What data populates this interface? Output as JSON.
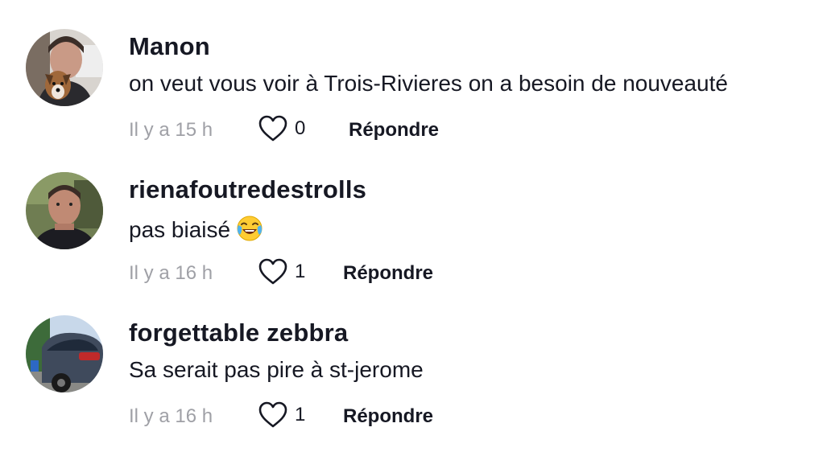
{
  "comments": [
    {
      "username": "Manon",
      "text": "on veut vous voir à Trois-Rivieres on a besoin de nouveauté",
      "time": "Il y a 15 h",
      "likes": "0",
      "reply_label": "Répondre",
      "like_icon": "heart-outline-icon",
      "avatar": "user-avatar-with-dog"
    },
    {
      "username": "rienafoutredestrolls",
      "text": "pas biaisé",
      "emoji": "face-with-tears-of-joy",
      "time": "Il y a 16 h",
      "likes": "1",
      "reply_label": "Répondre",
      "like_icon": "heart-outline-icon",
      "avatar": "user-avatar-man"
    },
    {
      "username": "forgettable zebbra",
      "text": "Sa serait pas pire à st-jerome",
      "time": "Il y a 16 h",
      "likes": "1",
      "reply_label": "Répondre",
      "like_icon": "heart-outline-icon",
      "avatar": "user-avatar-car"
    }
  ],
  "colors": {
    "primary_text": "#161823",
    "secondary_text": "#9fa0a6",
    "icon_stroke": "#161823"
  }
}
